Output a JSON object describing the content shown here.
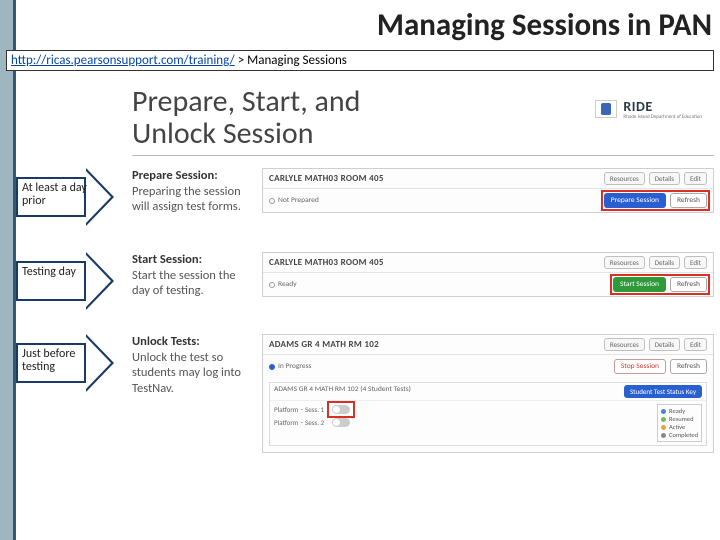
{
  "title": "Managing Sessions in PAN",
  "breadcrumb": {
    "link_text": "http://ricas.pearsonsupport.com/training/",
    "sep": " > ",
    "tail": "Managing Sessions"
  },
  "hero": {
    "line1": "Prepare, Start, and",
    "line2": "Unlock Session"
  },
  "ride": {
    "brand": "RIDE",
    "sub": "Rhode Island Department of Education"
  },
  "arrows": {
    "a1": "At least a day prior",
    "a2": "Testing day",
    "a3": "Just before testing"
  },
  "sections": {
    "s1": {
      "heading": "Prepare Session:",
      "desc": "Preparing the session will assign test forms."
    },
    "s2": {
      "heading": "Start Session:",
      "desc": "Start the session the day of testing."
    },
    "s3": {
      "heading": "Unlock Tests:",
      "desc": "Unlock the test so students may log into TestNav."
    }
  },
  "panel1": {
    "name": "CARLYLE MATH03 ROOM 405",
    "tool_resources": "Resources",
    "tool_details": "Details",
    "tool_edit": "Edit",
    "status": "Not Prepared",
    "btn_primary": "Prepare Session",
    "btn_secondary": "Refresh"
  },
  "panel2": {
    "name": "CARLYLE MATH03 ROOM 405",
    "tool_resources": "Resources",
    "tool_details": "Details",
    "tool_edit": "Edit",
    "status": "Ready",
    "btn_primary": "Start Session",
    "btn_secondary": "Refresh"
  },
  "panel3": {
    "name": "ADAMS GR 4 MATH RM 102",
    "tool_resources": "Resources",
    "tool_details": "Details",
    "tool_edit": "Edit",
    "status": "In Progress",
    "btn_primary": "Stop Session",
    "btn_secondary": "Refresh",
    "sub_name": "ADAMS GR 4 MATH RM 102 (4 Student Tests)",
    "sub_btn": "Student Test Status Key",
    "unit1": "Platform – Sess. 1",
    "unit2": "Platform – Sess. 2",
    "key": {
      "ready": "Ready",
      "resumed": "Resumed",
      "active": "Active",
      "completed": "Completed"
    }
  }
}
